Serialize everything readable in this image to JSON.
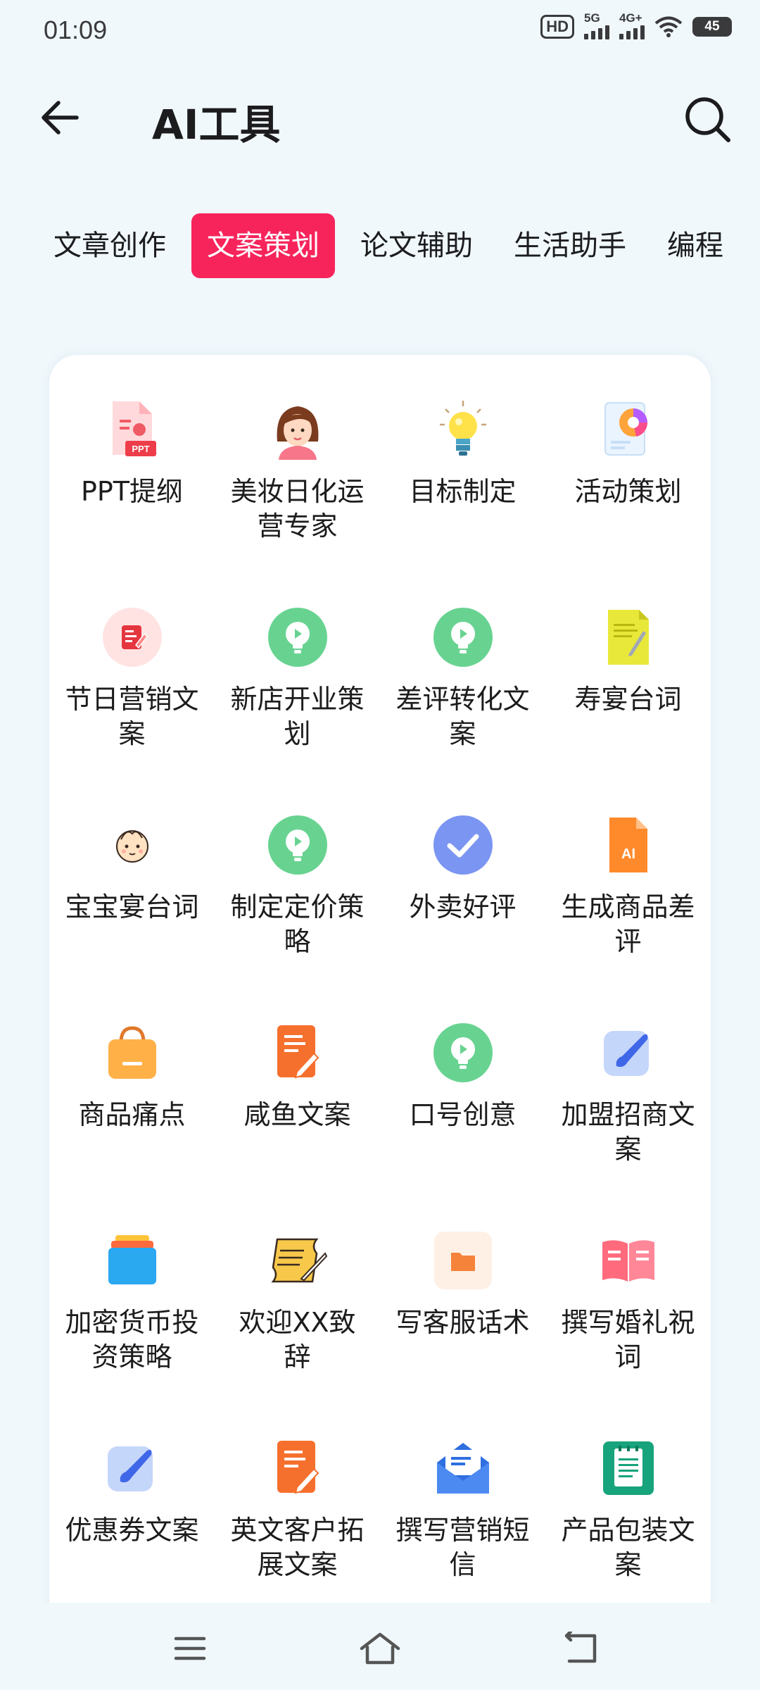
{
  "status_bar": {
    "time": "01:09",
    "hd_label": "HD",
    "signal1_label": "5G",
    "signal2_label": "4G+",
    "battery": "45"
  },
  "header": {
    "title": "AI工具",
    "back_icon": "arrow-left-icon",
    "search_icon": "search-icon"
  },
  "tabs": [
    {
      "label": "文章创作",
      "active": false
    },
    {
      "label": "文案策划",
      "active": true
    },
    {
      "label": "论文辅助",
      "active": false
    },
    {
      "label": "生活助手",
      "active": false
    },
    {
      "label": "编程",
      "active": false
    }
  ],
  "tools": [
    {
      "label": "PPT提纲",
      "icon": "ppt-file-icon"
    },
    {
      "label": "美妆日化运营专家",
      "icon": "woman-avatar-icon"
    },
    {
      "label": "目标制定",
      "icon": "lightbulb-icon"
    },
    {
      "label": "活动策划",
      "icon": "pie-chart-icon"
    },
    {
      "label": "节日营销文案",
      "icon": "edit-note-icon"
    },
    {
      "label": "新店开业策划",
      "icon": "green-bulb-icon"
    },
    {
      "label": "差评转化文案",
      "icon": "green-bulb-icon"
    },
    {
      "label": "寿宴台词",
      "icon": "yellow-document-icon"
    },
    {
      "label": "宝宝宴台词",
      "icon": "baby-face-icon"
    },
    {
      "label": "制定定价策略",
      "icon": "green-bulb-icon"
    },
    {
      "label": "外卖好评",
      "icon": "check-circle-icon"
    },
    {
      "label": "生成商品差评",
      "icon": "ai-file-icon"
    },
    {
      "label": "商品痛点",
      "icon": "shopping-bag-icon"
    },
    {
      "label": "咸鱼文案",
      "icon": "orange-document-edit-icon"
    },
    {
      "label": "口号创意",
      "icon": "green-bulb-icon"
    },
    {
      "label": "加盟招商文案",
      "icon": "paint-brush-icon"
    },
    {
      "label": "加密货币投资策略",
      "icon": "stacked-cards-icon"
    },
    {
      "label": "欢迎XX致辞",
      "icon": "scroll-quill-icon"
    },
    {
      "label": "写客服话术",
      "icon": "folder-icon"
    },
    {
      "label": "撰写婚礼祝词",
      "icon": "open-book-icon"
    },
    {
      "label": "优惠券文案",
      "icon": "paint-brush-icon"
    },
    {
      "label": "英文客户拓展文案",
      "icon": "orange-document-edit-icon"
    },
    {
      "label": "撰写营销短信",
      "icon": "envelope-icon"
    },
    {
      "label": "产品包装文案",
      "icon": "green-notepad-icon"
    }
  ],
  "nav": {
    "menu_icon": "menu-icon",
    "home_icon": "home-icon",
    "back_icon": "back-return-icon"
  },
  "colors": {
    "accent": "#f7245b",
    "background": "#f0f8fc",
    "green_icon": "#68d391"
  }
}
